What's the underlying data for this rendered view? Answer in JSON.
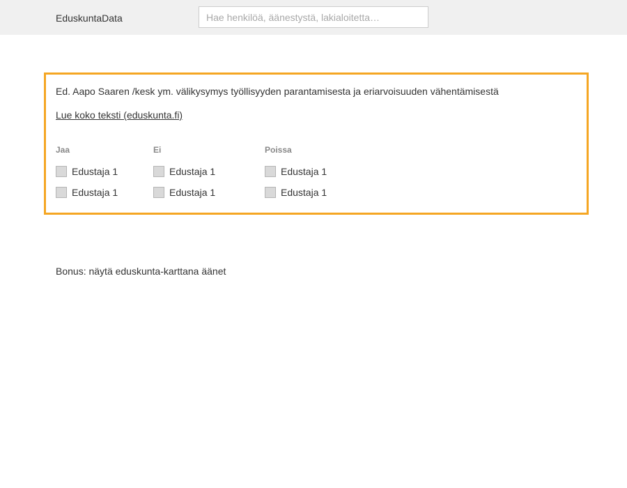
{
  "header": {
    "brand": "EduskuntaData",
    "search_placeholder": "Hae henkilöä, äänestystä, lakialoitetta…",
    "search_value": ""
  },
  "vote": {
    "title": "Ed. Aapo Saaren /kesk ym. välikysymys työllisyyden parantamisesta ja eriarvoisuuden vähentämisestä",
    "link_label": "Lue koko teksti (eduskunta.fi)",
    "columns": [
      {
        "heading": "Jaa",
        "members": [
          "Edustaja 1",
          "Edustaja 1"
        ]
      },
      {
        "heading": "Ei",
        "members": [
          "Edustaja 1",
          "Edustaja 1"
        ]
      },
      {
        "heading": "Poissa",
        "members": [
          "Edustaja 1",
          "Edustaja 1"
        ]
      }
    ]
  },
  "bonus_text": "Bonus: näytä eduskunta-karttana äänet",
  "colors": {
    "accent_border": "#f5a623",
    "header_bg": "#f0f0f0"
  }
}
